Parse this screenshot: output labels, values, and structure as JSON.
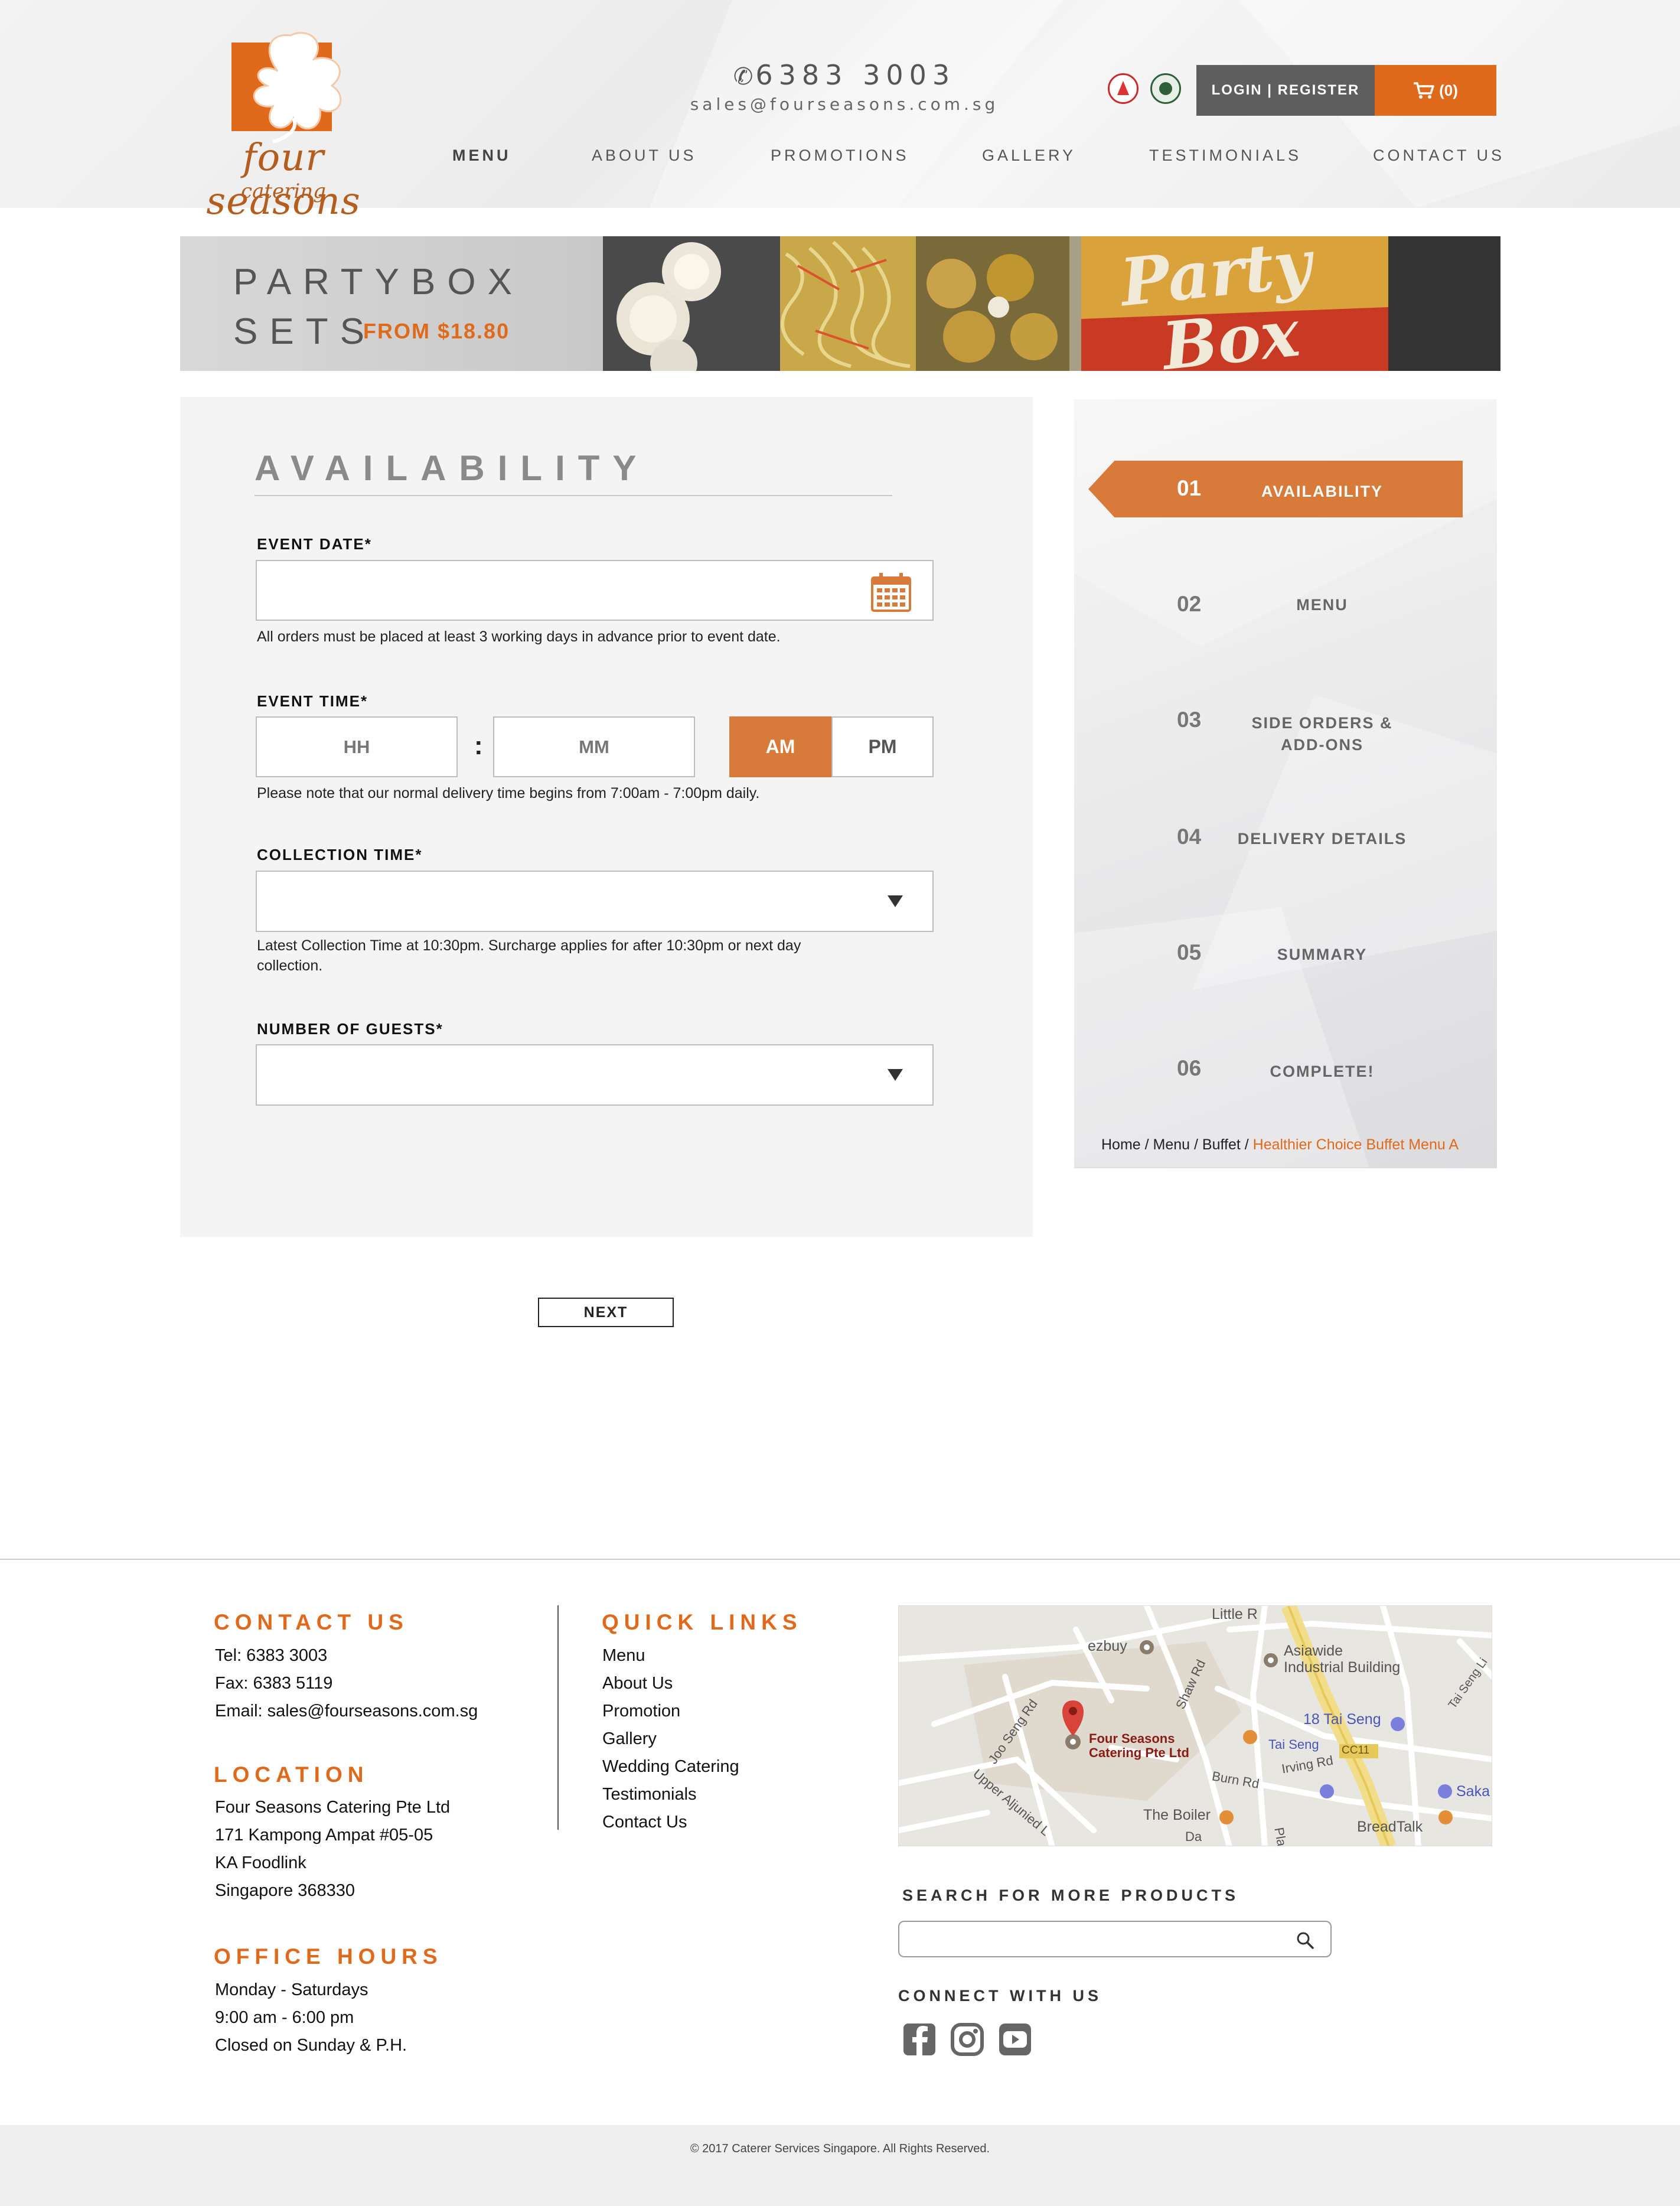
{
  "header": {
    "brand_name": "four seasons",
    "brand_sub": "catering",
    "phone": "6383 3003",
    "email": "sales@fourseasons.com.sg",
    "login_label": "LOGIN | REGISTER",
    "cart_label": "(0)",
    "nav": [
      "MENU",
      "ABOUT US",
      "PROMOTIONS",
      "GALLERY",
      "TESTIMONIALS",
      "CONTACT US"
    ]
  },
  "banner": {
    "line1": "PARTYBOX",
    "line2": "SETS",
    "price": "FROM $18.80",
    "image_text": "Party Box"
  },
  "form": {
    "title": "AVAILABILITY",
    "event_date_label": "EVENT DATE*",
    "event_date_value": "",
    "event_date_help": "All orders must be placed at least 3 working days in advance prior to event date.",
    "event_time_label": "EVENT TIME*",
    "hh_placeholder": "HH",
    "mm_placeholder": "MM",
    "colon": ":",
    "am_label": "AM",
    "pm_label": "PM",
    "selected_period": "AM",
    "event_time_help": "Please note that our normal delivery time begins from 7:00am - 7:00pm daily.",
    "collection_time_label": "COLLECTION TIME*",
    "collection_time_value": "",
    "collection_help_1": "Latest Collection Time at 10:30pm. Surcharge applies for after 10:30pm or next day",
    "collection_help_2": "collection.",
    "guests_label": "NUMBER OF GUESTS*",
    "guests_value": "",
    "next_label": "NEXT"
  },
  "steps": {
    "active": "01",
    "items": [
      {
        "num": "01",
        "label": "AVAILABILITY"
      },
      {
        "num": "02",
        "label": "MENU"
      },
      {
        "num": "03",
        "label": "SIDE ORDERS &\nADD-ONS"
      },
      {
        "num": "04",
        "label": "DELIVERY DETAILS"
      },
      {
        "num": "05",
        "label": "SUMMARY"
      },
      {
        "num": "06",
        "label": "COMPLETE!"
      }
    ],
    "breadcrumb": {
      "home": "Home",
      "menu": "Menu",
      "buffet": "Buffet",
      "sep": " / ",
      "current": "Healthier Choice Buffet Menu A"
    }
  },
  "footer": {
    "contact_head": "CONTACT US",
    "tel": "Tel: 6383 3003",
    "fax": "Fax: 6383 5119",
    "email": "Email: sales@fourseasons.com.sg",
    "location_head": "LOCATION",
    "addr1": "Four Seasons Catering Pte Ltd",
    "addr2": "171 Kampong Ampat #05-05",
    "addr3": "KA Foodlink",
    "addr4": "Singapore 368330",
    "hours_head": "OFFICE HOURS",
    "hours1": "Monday - Saturdays",
    "hours2": "9:00 am - 6:00 pm",
    "hours3": "Closed on Sunday & P.H.",
    "quick_head": "QUICK LINKS",
    "quick_links": [
      "Menu",
      "About Us",
      "Promotion",
      "Gallery",
      "Wedding Catering",
      "Testimonials",
      "Contact Us"
    ],
    "map_labels": {
      "little": "Little R",
      "ezbuy": "ezbuy",
      "asiawide1": "Asiawide",
      "asiawide2": "Industrial Building",
      "fs1": "Four Seasons",
      "fs2": "Catering Pte Ltd",
      "taiseng18": "18 Tai Seng",
      "taiseng": "Tai Seng",
      "cc11": "CC11",
      "irving": "Irving Rd",
      "burn": "Burn Rd",
      "boiler": "The Boiler",
      "breadtalk": "BreadTalk",
      "saka": "Saka",
      "jooseng": "Joo Seng Rd",
      "upper": "Upper Aljunied L",
      "shaw": "Shaw Rd",
      "taisengr": "Tai Seng Li",
      "da": "Da",
      "pla": "Pla"
    },
    "search_head": "SEARCH FOR MORE PRODUCTS",
    "search_value": "",
    "connect_head": "CONNECT WITH US",
    "social": [
      "facebook-icon",
      "instagram-icon",
      "youtube-icon"
    ],
    "copyright": "© 2017 Caterer Services Singapore. All Rights Reserved."
  },
  "colors": {
    "accent": "#e06a1c",
    "step_active": "#d77a3a",
    "login_bg": "#5e5e5e"
  }
}
